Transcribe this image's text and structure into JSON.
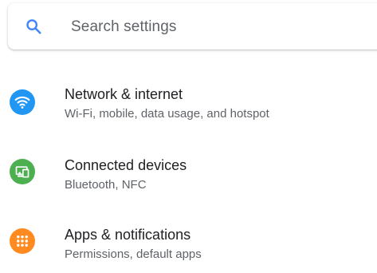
{
  "search": {
    "placeholder": "Search settings",
    "icon": "search-icon"
  },
  "colors": {
    "search_icon": "#4285f4",
    "network": "#2196f3",
    "devices": "#4caf50",
    "apps": "#ff8a1f"
  },
  "settings_items": [
    {
      "title": "Network & internet",
      "subtitle": "Wi-Fi, mobile, data usage, and hotspot",
      "icon": "wifi-icon"
    },
    {
      "title": "Connected devices",
      "subtitle": "Bluetooth, NFC",
      "icon": "devices-icon"
    },
    {
      "title": "Apps & notifications",
      "subtitle": "Permissions, default apps",
      "icon": "apps-grid-icon"
    }
  ]
}
